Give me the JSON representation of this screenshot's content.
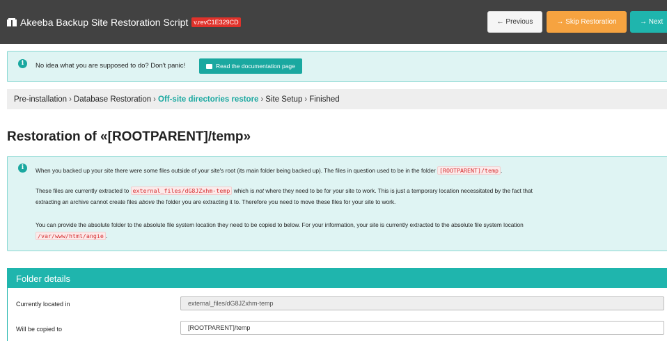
{
  "header": {
    "title": "Akeeba Backup Site Restoration Script",
    "version": "v.revC1E329CD",
    "buttons": {
      "previous": "← Previous",
      "skip": "→ Skip Restoration",
      "next": "→ Next"
    }
  },
  "help": {
    "text": "No idea what you are supposed to do? Don't panic!",
    "button": "Read the documentation page"
  },
  "breadcrumbs": [
    "Pre-installation",
    "Database Restoration",
    "Off-site directories restore",
    "Site Setup",
    "Finished"
  ],
  "page_title": "Restoration of «[ROOTPARENT]/temp»",
  "notice": {
    "p1_a": "When you backed up your site there were some files outside of your site's root (its main folder being backed up). The files in question used to be in the folder",
    "p1_code": "[ROOTPARENT]/temp",
    "p1_b": ".",
    "p2_a": "These files are currently extracted to",
    "p2_code": "external_files/dG8JZxhm-temp",
    "p2_b": "which is",
    "p2_em": "not",
    "p2_c": "where they need to be for your site to work. This is just a temporary location necessitated by the fact that",
    "p2_d": "extracting an archive cannot create files",
    "p2_em2": "above",
    "p2_e": "the folder you are extracting it to. Therefore you need to move these files for your site to work.",
    "p3_a": "You can provide the absolute folder to the absolute file system location they need to be copied to below. For your information, your site is currently extracted to the absolute file system location",
    "p3_code": "/var/www/html/angie",
    "p3_b": "."
  },
  "folder_details": {
    "heading": "Folder details",
    "current_label": "Currently located in",
    "current_value": "external_files/dG8JZxhm-temp",
    "target_label": "Will be copied to",
    "target_value": "[ROOTPARENT]/temp"
  }
}
